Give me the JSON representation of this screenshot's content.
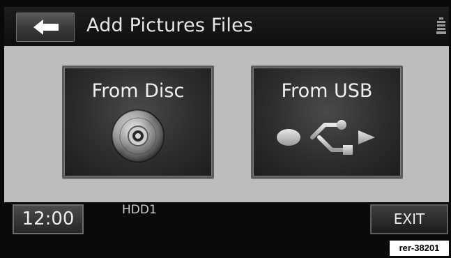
{
  "header": {
    "title": "Add Pictures Files",
    "back_icon": "arrow-left-icon",
    "status_icon": "stacked-discs-icon"
  },
  "tiles": [
    {
      "label": "From Disc",
      "icon": "disc-icon"
    },
    {
      "label": "From USB",
      "icon": "usb-icon"
    }
  ],
  "footer": {
    "clock": "12:00",
    "source": "HDD1",
    "exit_label": "EXIT"
  },
  "reference_label": "rer-38201",
  "colors": {
    "background": "#0a0a0a",
    "panel": "#bdbdbd",
    "tile": "#2d2d2d",
    "text": "#f0f0f0"
  }
}
